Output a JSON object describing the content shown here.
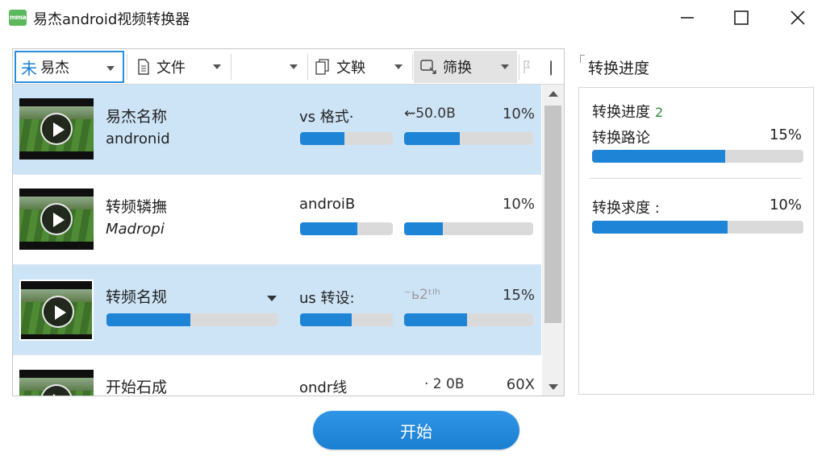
{
  "window": {
    "icon_text": "mma",
    "title": "易杰android视频转换器"
  },
  "toolbar": {
    "items": [
      {
        "icon_glyph": "未",
        "label": "易杰"
      },
      {
        "label": "文件"
      },
      {
        "label": ""
      },
      {
        "label": "文鞅"
      },
      {
        "label": "筛换"
      },
      {
        "label": "|"
      }
    ]
  },
  "file_list": {
    "rows": [
      {
        "name": "易杰名称",
        "subname": "andronid",
        "format": "vs 格式·",
        "size": "⇜50.0B",
        "percent": "10%",
        "format_progress": 0.48,
        "size_progress": 0.43,
        "selected": true
      },
      {
        "name": "转频辚撫",
        "subname": "Madropi",
        "format": "androiB",
        "size": "",
        "percent": "10%",
        "format_progress": 0.62,
        "size_progress": 0.3,
        "selected": false
      },
      {
        "name": "转频名规",
        "subname": "",
        "format": "us 转设:",
        "size": "⁻ь2ᵗᴵʰ",
        "percent": "15%",
        "name_progress": 0.49,
        "format_progress": 0.56,
        "size_progress": 0.49,
        "selected": true
      },
      {
        "name": "开始石成",
        "subname": "",
        "format": "ondr线",
        "size": "· 2 0B",
        "percent": "60X",
        "selected": false
      }
    ]
  },
  "progress_panel": {
    "heading": "转换进度",
    "sections": [
      {
        "label": "转换进度",
        "count": "2",
        "sublabel": "转换路论",
        "percent": "15%",
        "progress": 0.63
      },
      {
        "label": "转换求度 :",
        "percent": "10%",
        "progress": 0.64
      }
    ]
  },
  "actions": {
    "start_label": "开始"
  },
  "colors": {
    "accent": "#1e84d6",
    "selected_row": "#cde4f7",
    "bar_track": "#dadada"
  }
}
